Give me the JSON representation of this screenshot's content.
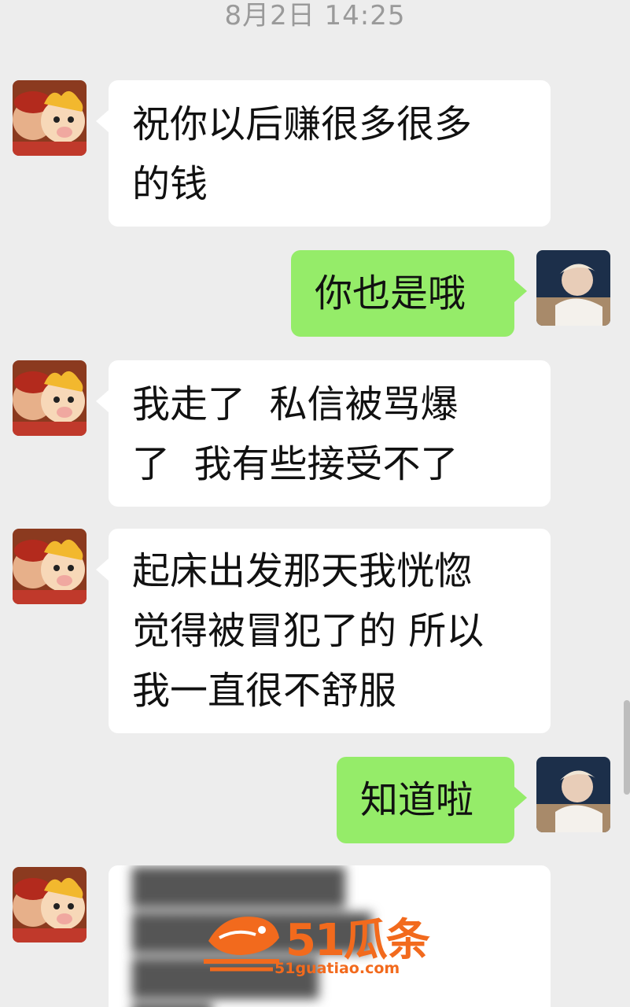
{
  "chat": {
    "timestamp": "8月2日 14:25",
    "messages": [
      {
        "from": "other",
        "text": "祝你以后赚很多很多\n的钱"
      },
      {
        "from": "me",
        "text": "你也是哦"
      },
      {
        "from": "other",
        "text": "我走了  私信被骂爆\n了  我有些接受不了"
      },
      {
        "from": "other",
        "text": "起床出发那天我恍惚\n觉得被冒犯了的 所以\n我一直很不舒服"
      },
      {
        "from": "me",
        "text": "知道啦"
      },
      {
        "from": "other",
        "text": "████████\n█████████\n███████\n███",
        "blurred": true
      }
    ]
  },
  "watermark": {
    "brand": "51瓜条",
    "url": "51guatiao.com",
    "color": "#f26a1d"
  },
  "colors": {
    "background": "#ededed",
    "incoming_bubble": "#ffffff",
    "outgoing_bubble": "#95ec69"
  },
  "icons": {
    "other_avatar": "cartoon-pig-avatar-icon",
    "me_avatar": "person-photo-avatar-icon",
    "watermark_logo": "fish-logo-icon"
  }
}
